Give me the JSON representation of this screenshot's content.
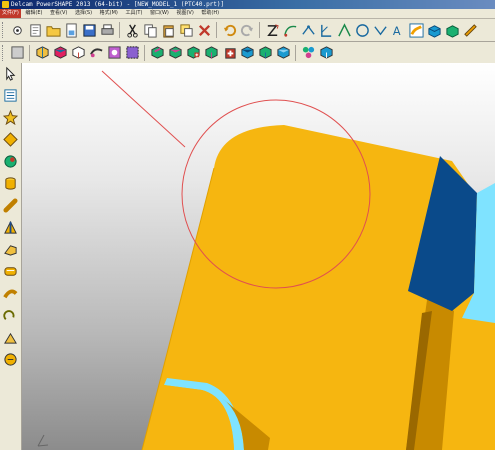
{
  "window": {
    "title": "Delcam PowerSHAPE 2013 (64-bit) - [NEW_MODEL_1 (PTC40.prt)]"
  },
  "menubar": {
    "items": [
      "文件(F)",
      "编辑(E)",
      "查看(V)",
      "选择(S)",
      "格式(M)",
      "工具(T)",
      "窗口(W)",
      "视图(V)",
      "帮助(H)"
    ]
  },
  "toolbar_top": {
    "icons": [
      "new-icon",
      "open-icon",
      "open-folder-icon",
      "save-icon",
      "print-icon",
      "cut-icon",
      "copy-icon",
      "paste-icon",
      "selection-icon",
      "delete-icon",
      "undo-icon",
      "redo-icon",
      "line-icon",
      "arc-icon",
      "curve-icon",
      "dimension-icon",
      "angle-icon",
      "circle-icon",
      "text-icon",
      "symbol-icon",
      "surface-icon",
      "solid-icon",
      "electrode-icon",
      "ruler-icon"
    ]
  },
  "toolbar_second": {
    "icons": [
      "shaded-icon",
      "wireframe-icon",
      "solid-shade-icon",
      "surface-shade-icon",
      "hidden-line-icon",
      "view-box-icon",
      "view-select-icon",
      "feature-add-icon",
      "feature-cut-icon",
      "feature-boolean-icon",
      "feature-move-icon",
      "feature-fillet-icon",
      "feature-shell-icon",
      "feature-draft-icon",
      "assembly-icon",
      "component-icon"
    ]
  },
  "toolbar_left": {
    "icons": [
      "select-arrow-icon",
      "workplane-icon",
      "star-point-icon",
      "diamond-icon",
      "globe-icon",
      "cylinder-icon",
      "cone-icon",
      "prism-icon",
      "wedge-icon",
      "tube-icon",
      "sweep-icon",
      "spring-icon",
      "blend-icon",
      "fillet-icon"
    ]
  },
  "colors": {
    "part": "#f6b610",
    "part_shadow": "#c88a00",
    "part_dark": "#9a6800",
    "face_blue_dark": "#0a4a8a",
    "face_cyan": "#7fe3ff",
    "annotation_circle": "#e05050",
    "background_top": "#ffffff",
    "background_bottom": "#8c8c8c"
  }
}
